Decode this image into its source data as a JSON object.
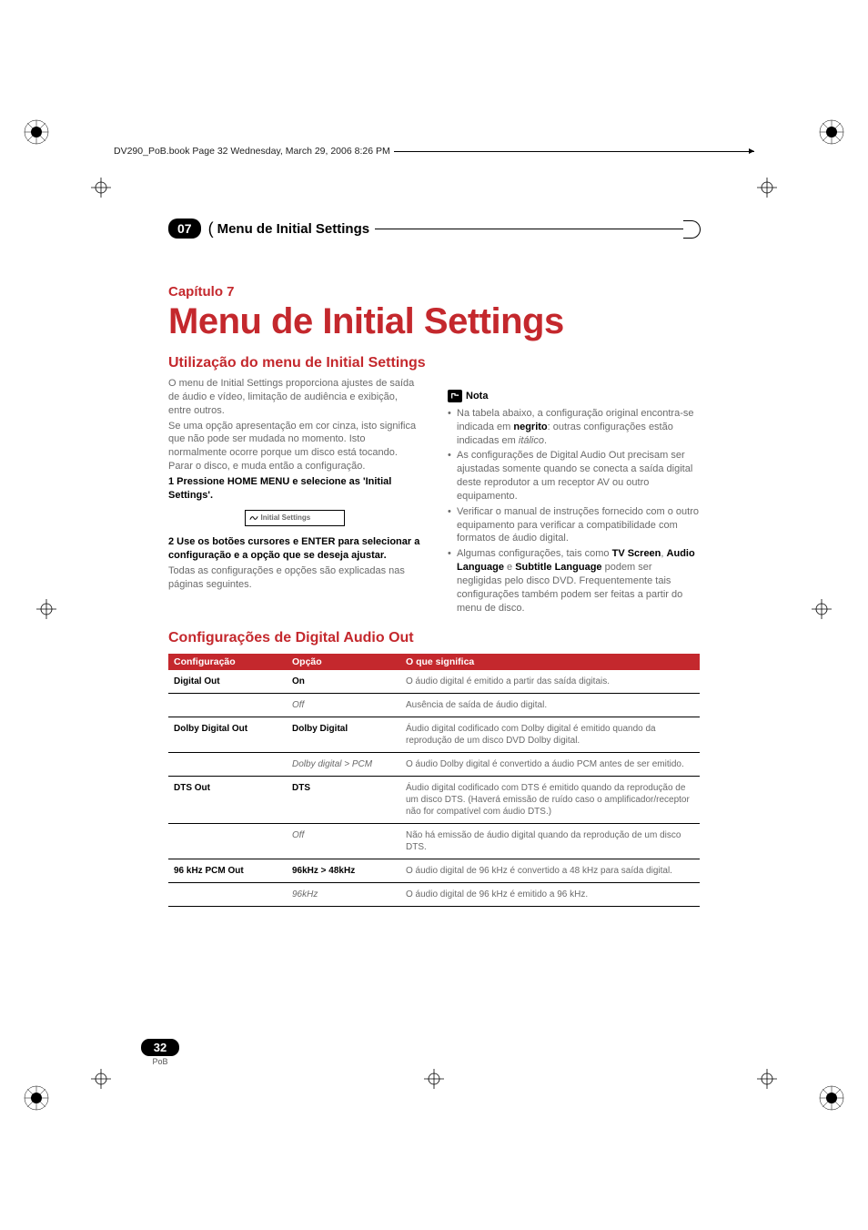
{
  "header_text": "DV290_PoB.book  Page 32  Wednesday, March 29, 2006  8:26 PM",
  "chapter_number": "07",
  "chapter_bar_title": "Menu de Initial Settings",
  "chapter_label": "Capítulo 7",
  "main_title": "Menu de Initial Settings",
  "section1_title": "Utilização do menu de Initial Settings",
  "left": {
    "p1": "O menu de Initial Settings proporciona ajustes de saída de áudio e vídeo, limitação de audiência e exibição, entre outros.",
    "p2": "Se uma opção apresentação em cor cinza, isto significa que não pode ser mudada no momento. Isto normalmente ocorre porque um disco está tocando. Parar o disco, e muda então a configuração.",
    "step1": "1    Pressione HOME MENU e selecione as 'Initial Settings'.",
    "gui_label": "Initial Settings",
    "step2": "2    Use os botões cursores e ENTER para selecionar a configuração e a opção que se deseja ajustar.",
    "p3": "Todas as configurações e opções são explicadas nas páginas seguintes."
  },
  "note_label": "Nota",
  "notes": {
    "n1a": "Na tabela abaixo, a configuração original encontra-se indicada em ",
    "n1b": "negrito",
    "n1c": ": outras configurações estão indicadas em ",
    "n1d": "itálico",
    "n1e": ".",
    "n2": "As configurações de Digital Audio Out precisam ser ajustadas somente quando se conecta a saída digital deste reprodutor a um receptor AV ou outro equipamento.",
    "n3": "Verificar o manual de instruções fornecido com o outro equipamento para verificar a compatibilidade com formatos de áudio digital.",
    "n4a": "Algumas configurações, tais como ",
    "n4b": "TV Screen",
    "n4c": ", ",
    "n4d": "Audio Language",
    "n4e": " e ",
    "n4f": "Subtitle Language",
    "n4g": " podem ser negligidas pelo disco DVD. Frequentemente tais configurações também podem ser feitas a partir do menu de disco."
  },
  "section2_title": "Configurações de Digital Audio Out",
  "table": {
    "h1": "Configuração",
    "h2": "Opção",
    "h3": "O que significa",
    "rows": [
      {
        "cfg": "Digital Out",
        "opt": "On",
        "opt_style": "bold",
        "desc": "O áudio digital é emitido a partir das saída digitais."
      },
      {
        "cfg": "",
        "opt": "Off",
        "opt_style": "italic",
        "desc": "Ausência de saída de áudio digital."
      },
      {
        "cfg": "Dolby Digital Out",
        "opt": "Dolby Digital",
        "opt_style": "bold",
        "desc": "Áudio digital codificado com Dolby digital é emitido quando da reprodução de um disco DVD Dolby digital."
      },
      {
        "cfg": "",
        "opt": "Dolby digital > PCM",
        "opt_style": "italic",
        "desc": "O áudio Dolby digital é convertido a áudio PCM antes de ser emitido."
      },
      {
        "cfg": "DTS Out",
        "opt": "DTS",
        "opt_style": "bold",
        "desc": "Áudio digital codificado com DTS é emitido quando da reprodução de um disco DTS. (Haverá emissão de ruído caso o amplificador/receptor não for compatível com áudio DTS.)"
      },
      {
        "cfg": "",
        "opt": "Off",
        "opt_style": "italic",
        "desc": "Não há emissão de áudio digital quando da reprodução de um disco DTS."
      },
      {
        "cfg": "96 kHz PCM Out",
        "opt": "96kHz > 48kHz",
        "opt_style": "bold",
        "desc": "O áudio digital de 96 kHz é convertido a 48 kHz para saída digital."
      },
      {
        "cfg": "",
        "opt": "96kHz",
        "opt_style": "italic",
        "desc": "O áudio digital de 96 kHz é emitido a 96 kHz."
      }
    ]
  },
  "page_number": "32",
  "page_lang": "PoB"
}
